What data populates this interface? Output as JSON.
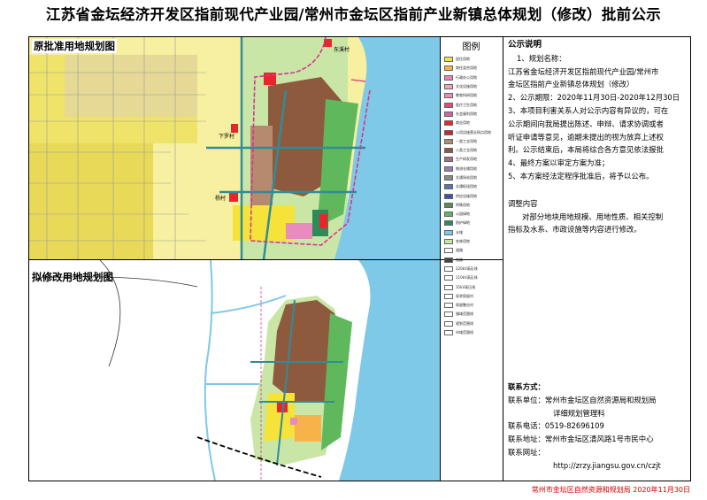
{
  "title": "江苏省金坛经济开发区指前现代产业园/常州市金坛区指前产业新镇总体规划（修改）批前公示",
  "panels": {
    "original": "原批准用地规划图",
    "revised": "拟修改用地规划图"
  },
  "map_labels": {
    "place1": "东溪村",
    "place2": "下罗村",
    "place3": "杨村"
  },
  "legend": {
    "title": "图例",
    "items": [
      {
        "label": "居住用地",
        "color": "#f5e33a"
      },
      {
        "label": "商住混合用地",
        "color": "#f7b24a"
      },
      {
        "label": "行政办公用地",
        "color": "#f07cb6"
      },
      {
        "label": "文化设施用地",
        "color": "#f3a0c4"
      },
      {
        "label": "教育科研用地",
        "color": "#e88cc0"
      },
      {
        "label": "医疗卫生用地",
        "color": "#e04c7c"
      },
      {
        "label": "社会福利用地",
        "color": "#c96b9c"
      },
      {
        "label": "商业用地",
        "color": "#e6262a"
      },
      {
        "label": "公用设施营业网点用地",
        "color": "#c2282e"
      },
      {
        "label": "一类工业用地",
        "color": "#b58a6e"
      },
      {
        "label": "二类工业用地",
        "color": "#8e5a3d"
      },
      {
        "label": "生产研发用地",
        "color": "#a06f80"
      },
      {
        "label": "物流仓储用地",
        "color": "#9b7bb0"
      },
      {
        "label": "交通场站用地",
        "color": "#8a8a8a"
      },
      {
        "label": "交通枢纽用地",
        "color": "#5872b8"
      },
      {
        "label": "供应设施用地",
        "color": "#3a53a4"
      },
      {
        "label": "特殊用地",
        "color": "#5b8e4e"
      },
      {
        "label": "公园绿地",
        "color": "#5fb85b"
      },
      {
        "label": "防护绿地",
        "color": "#2e8b57"
      },
      {
        "label": "水域",
        "color": "#7ec8e8"
      },
      {
        "label": "农林用地",
        "color": "#c9e6a6"
      },
      {
        "label": "道路",
        "color": "#ffffff"
      },
      {
        "label": "铁路",
        "color": "#444444"
      },
      {
        "label": "220kV高压线",
        "color": "#ffffff"
      },
      {
        "label": "110kV高压线",
        "color": "#ffffff"
      },
      {
        "label": "35kV高压线",
        "color": "#ffffff"
      },
      {
        "label": "现状保留村",
        "color": "#ffffff"
      },
      {
        "label": "保留整治村",
        "color": "#ffffff"
      },
      {
        "label": "镇域范围线",
        "color": "#ffffff"
      },
      {
        "label": "规划范围线",
        "color": "#ffffff"
      },
      {
        "label": "市域范围线",
        "color": "#ffffff"
      }
    ]
  },
  "notice": {
    "heading": "公示说明",
    "l1": "1、规划名称：",
    "l2": "江苏省金坛经济开发区指前现代产业园/常州市",
    "l3": "金坛区指前产业新镇总体规划（修改）",
    "l4": "2、公示期限：2020年11月30日-2020年12月30日",
    "l5": "3、本项目利害关系人对公示内容有异议的，可在",
    "l6": "公示期间向我局提出陈述、申辩、请求协调或者",
    "l7": "听证申请等意见，逾期未提出的视为放弃上述权",
    "l8": "利。公示结束后，本局将综合各方意见依法报批",
    "l9": "4、最终方案以审定方案为准；",
    "l10": "5、本方案经法定程序批准后，将予以公布。",
    "h2": "调整内容",
    "c1": "对部分地块用地规模、用地性质、相关控制",
    "c2": "指标及水系、市政设施等内容进行修改。"
  },
  "contact": {
    "heading": "联系方式：",
    "unit_label": "联系单位：",
    "unit_value": "常州市金坛区自然资源局和规划局",
    "unit_value2": "详细规划管理科",
    "phone": "联系电话：0519-82696109",
    "addr_label": "联系地址：",
    "addr_value": "常州市金坛区清风路1号市民中心",
    "web_label": "联系网址：",
    "web_value": "http://zrzy.jiangsu.gov.cn/czjt"
  },
  "footer": "常州市金坛区自然资源和规划局 2020年11月30日",
  "colors": {
    "water": "#7ec8e8",
    "residential": "#f5e33a",
    "industrial": "#8e5a3d",
    "farmland": "#c9e6a6",
    "green": "#5fb85b",
    "boundary": "#d9358f"
  }
}
